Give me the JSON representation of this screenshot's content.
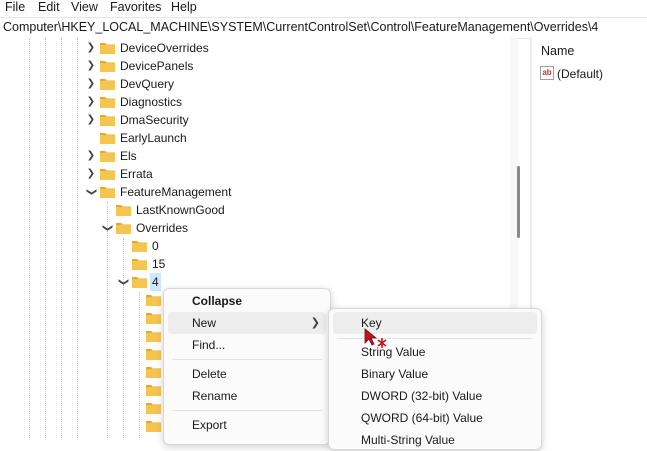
{
  "menubar": {
    "items": [
      "File",
      "Edit",
      "View",
      "Favorites",
      "Help"
    ]
  },
  "address": {
    "path": "Computer\\HKEY_LOCAL_MACHINE\\SYSTEM\\CurrentControlSet\\Control\\FeatureManagement\\Overrides\\4"
  },
  "tree": {
    "nodes": [
      {
        "label": "DeviceOverrides",
        "expanded": false
      },
      {
        "label": "DevicePanels",
        "expanded": false
      },
      {
        "label": "DevQuery",
        "expanded": false
      },
      {
        "label": "Diagnostics",
        "expanded": false
      },
      {
        "label": "DmaSecurity",
        "expanded": false
      },
      {
        "label": "EarlyLaunch",
        "expanded": false
      },
      {
        "label": "Els",
        "expanded": false
      },
      {
        "label": "Errata",
        "expanded": false
      },
      {
        "label": "FeatureManagement",
        "expanded": true
      },
      {
        "label": "LastKnownGood",
        "expanded": false
      },
      {
        "label": "Overrides",
        "expanded": true
      },
      {
        "label": "0",
        "expanded": false
      },
      {
        "label": "15",
        "expanded": false
      },
      {
        "label": "4",
        "expanded": true,
        "selected": true
      }
    ]
  },
  "values_pane": {
    "column_header": "Name",
    "rows": [
      {
        "icon": "string-value-icon",
        "name": "(Default)"
      }
    ]
  },
  "context_menu": {
    "items": [
      {
        "label": "Collapse",
        "bold": true
      },
      {
        "label": "New",
        "has_submenu": true,
        "highlighted": true
      },
      {
        "label": "Find..."
      },
      {
        "label": "Delete"
      },
      {
        "label": "Rename"
      },
      {
        "label": "Export"
      }
    ]
  },
  "new_submenu": {
    "items": [
      {
        "label": "Key",
        "highlighted": true
      },
      {
        "label": "String Value"
      },
      {
        "label": "Binary Value"
      },
      {
        "label": "DWORD (32-bit) Value"
      },
      {
        "label": "QWORD (64-bit) Value"
      },
      {
        "label": "Multi-String Value"
      }
    ]
  },
  "colors": {
    "folder": "#f5c451",
    "folder_dark": "#e0a82e",
    "selection": "#cce8ff",
    "menu_hover": "#ededed"
  }
}
